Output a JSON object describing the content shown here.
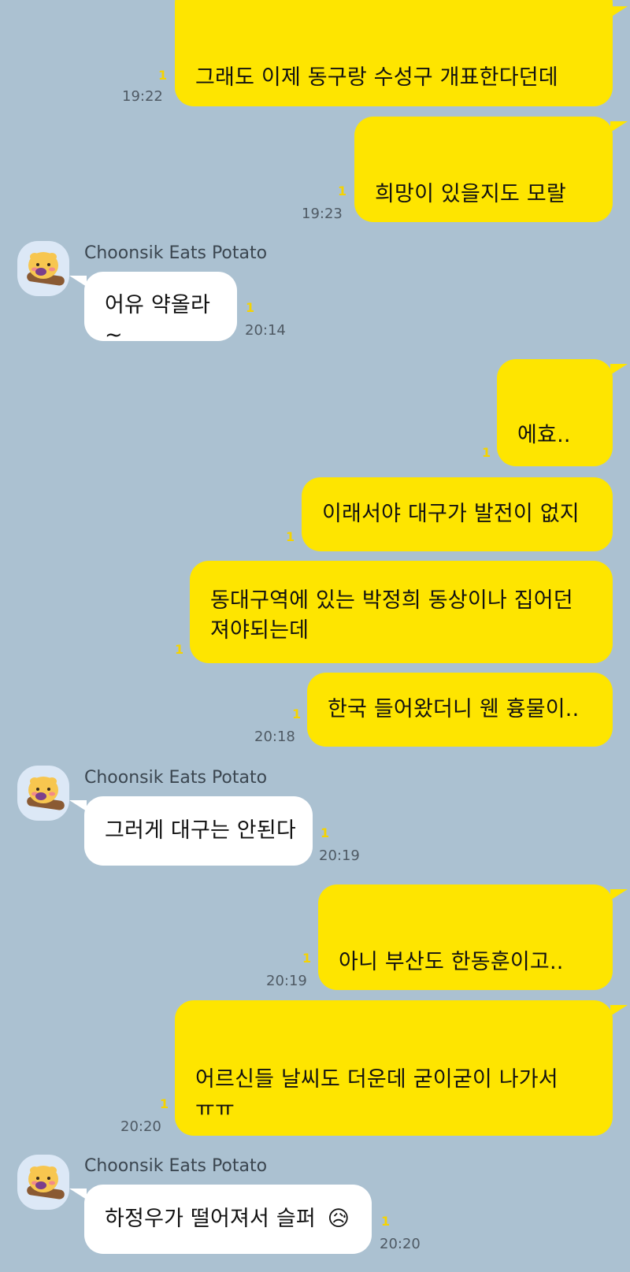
{
  "contact_name": "Choonsik Eats Potato",
  "unread_mark": "1",
  "colors": {
    "background": "#abc1d1",
    "my_bubble": "#fee500",
    "their_bubble": "#ffffff",
    "unread": "#f5d300",
    "time": "#4f5a64"
  },
  "messages": [
    {
      "from": "me",
      "text": "그래도 이제 동구랑 수성구 개표한다던데",
      "time": "19:22",
      "unread": "1"
    },
    {
      "from": "me",
      "text": "희망이 있을지도 모랄",
      "time": "19:23",
      "unread": "1"
    },
    {
      "from": "them",
      "sender": "Choonsik Eats Potato",
      "text": "어유 약올라~",
      "time": "20:14",
      "unread": "1"
    },
    {
      "from": "me",
      "text": "에효..",
      "time": "",
      "unread": "1"
    },
    {
      "from": "me",
      "text": "이래서야 대구가 발전이 없지",
      "time": "",
      "unread": "1"
    },
    {
      "from": "me",
      "line1": "동대구역에 있는 박정희 동상이나 집어던",
      "line2": "져야되는데",
      "time": "",
      "unread": "1"
    },
    {
      "from": "me",
      "text": "한국 들어왔더니 웬 흉물이..",
      "time": "20:18",
      "unread": "1"
    },
    {
      "from": "them",
      "sender": "Choonsik Eats Potato",
      "text": "그러게 대구는 안된다",
      "time": "20:19",
      "unread": "1"
    },
    {
      "from": "me",
      "text": "아니 부산도 한동훈이고..",
      "time": "20:19",
      "unread": "1"
    },
    {
      "from": "me",
      "line1": "어르신들 날씨도 더운데 굳이굳이 나가서",
      "line2": "ㅠㅠ",
      "time": "20:20",
      "unread": "1"
    },
    {
      "from": "them",
      "sender": "Choonsik Eats Potato",
      "text": "하정우가 떨어져서 슬퍼",
      "emoji": "😥",
      "time": "20:20",
      "unread": "1"
    }
  ]
}
